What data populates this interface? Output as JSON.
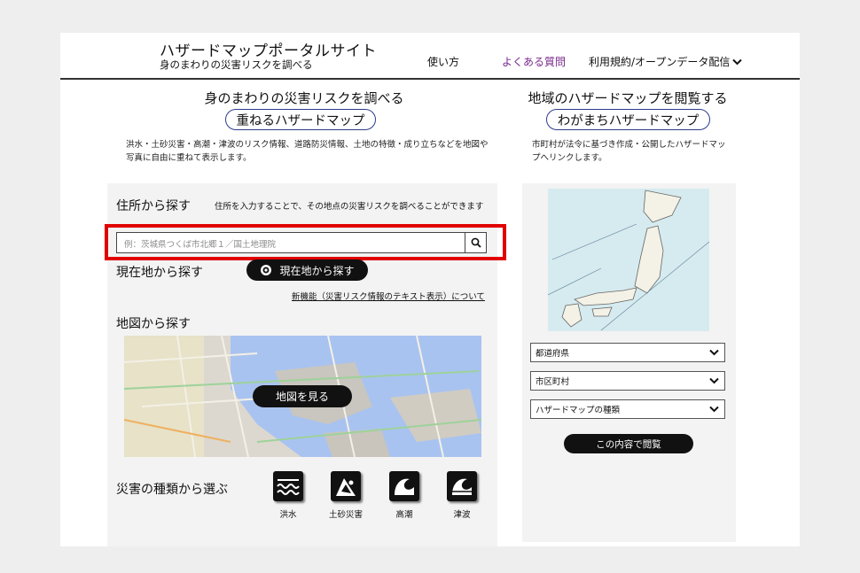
{
  "header": {
    "site_title": "ハザードマップポータルサイト",
    "site_subtitle": "身のまわりの災害リスクを調べる",
    "nav": {
      "usage": "使い方",
      "faq": "よくある質問",
      "terms": "利用規約/オープンデータ配信"
    }
  },
  "left": {
    "heading": "身のまわりの災害リスクを調べる",
    "pill": "重ねるハザードマップ",
    "description": "洪水・土砂災害・高潮・津波のリスク情報、道路防災情報、土地の特徴・成り立ちなどを地図や写真に自由に重ねて表示します。",
    "address": {
      "title": "住所から探す",
      "hint": "住所を入力することで、その地点の災害リスクを調べることができます",
      "placeholder": "例：茨城県つくば市北郷１／国土地理院"
    },
    "current": {
      "title": "現在地から探す",
      "button": "現在地から探す",
      "link": "新機能（災害リスク情報のテキスト表示）について"
    },
    "map": {
      "title": "地図から探す",
      "button": "地図を見る"
    },
    "types": {
      "title": "災害の種類から選ぶ",
      "items": [
        {
          "label": "洪水",
          "icon": "flood-icon"
        },
        {
          "label": "土砂災害",
          "icon": "landslide-icon"
        },
        {
          "label": "高潮",
          "icon": "storm-surge-icon"
        },
        {
          "label": "津波",
          "icon": "tsunami-icon"
        }
      ]
    }
  },
  "right": {
    "heading": "地域のハザードマップを閲覧する",
    "pill": "わがまちハザードマップ",
    "description": "市町村が法令に基づき作成・公開したハザードマップへリンクします。",
    "selects": {
      "prefecture": "都道府県",
      "municipality": "市区町村",
      "map_type": "ハザードマップの種類"
    },
    "button": "この内容で閲覧"
  },
  "colors": {
    "highlight": "#e00000",
    "faq_link": "#7a2a8c",
    "pill_border": "#2d3c8c"
  }
}
